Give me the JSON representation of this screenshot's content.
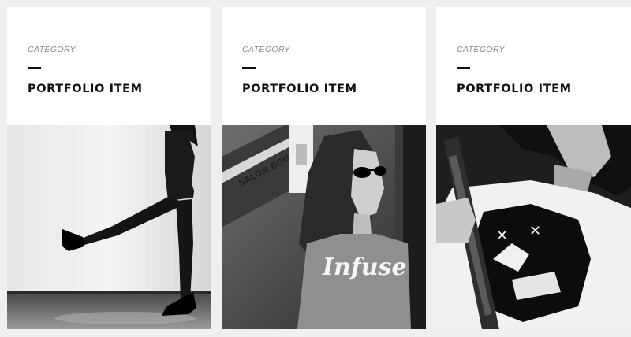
{
  "portfolio": {
    "items": [
      {
        "category": "CATEGORY",
        "title": "PORTFOLIO ITEM",
        "image": "woman-kicking-leg-photo"
      },
      {
        "category": "CATEGORY",
        "title": "PORTFOLIO ITEM",
        "image": "woman-infuse-tshirt-photo",
        "shirt_text": "Infuse",
        "sign_text": "SALON BOUTIQU"
      },
      {
        "category": "CATEGORY",
        "title": "PORTFOLIO ITEM",
        "image": "man-guitar-graphic-tee-photo"
      }
    ]
  },
  "colors": {
    "page_background": "#efefef",
    "card_background": "#ffffff",
    "title": "#111111",
    "category": "#8a8a8a"
  }
}
